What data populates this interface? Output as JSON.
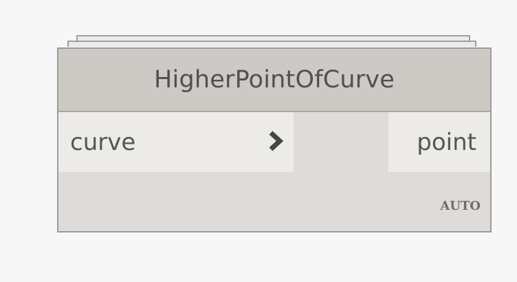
{
  "node": {
    "title": "HigherPointOfCurve",
    "input_port": {
      "label": "curve",
      "icon": "chevron-right-icon"
    },
    "output_port": {
      "label": "point"
    },
    "lacing_label": "AUTO"
  },
  "colors": {
    "canvas": "#f7f7f7",
    "header": "#cdc9c5",
    "body": "#dedbd8",
    "port": "#edebe8",
    "border": "#9b9b9b",
    "text": "#555555"
  }
}
